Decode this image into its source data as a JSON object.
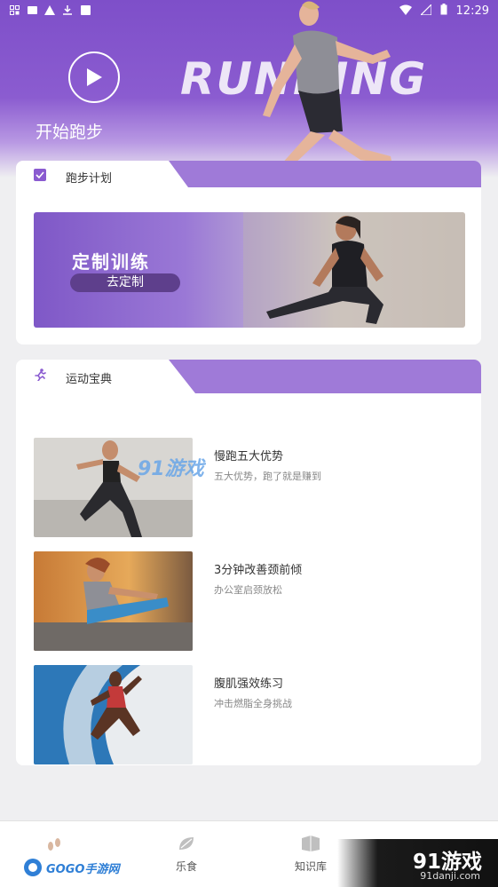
{
  "status_bar": {
    "time": "12:29",
    "left_icons": [
      "notification-icon",
      "mail-icon",
      "warning-icon",
      "download-icon",
      "font-icon"
    ],
    "right_icons": [
      "wifi-icon",
      "signal-icon",
      "battery-icon"
    ]
  },
  "hero": {
    "brand_word": "RUNNING",
    "start_label": "开始跑步"
  },
  "plan": {
    "section_title": "跑步计划",
    "banner_title": "定制训练",
    "banner_button": "去定制"
  },
  "handbook": {
    "section_title": "运动宝典",
    "articles": [
      {
        "title": "慢跑五大优势",
        "subtitle": "五大优势，跑了就是赚到"
      },
      {
        "title": "3分钟改善颈前倾",
        "subtitle": "办公室启颈放松"
      },
      {
        "title": "腹肌强效练习",
        "subtitle": "冲击燃脂全身挑战"
      }
    ]
  },
  "watermarks": {
    "mid_91": "91游戏",
    "gogo": "GOGO手游网",
    "logo_91": "91游戏",
    "logo_url": "91danji.com"
  },
  "bottom_nav": {
    "items": [
      {
        "label": "乐食",
        "icon": "leaf-icon"
      },
      {
        "label": "知识库",
        "icon": "book-icon"
      }
    ]
  },
  "colors": {
    "accent": "#8a5bd0",
    "tab": "#9f7ad8"
  }
}
